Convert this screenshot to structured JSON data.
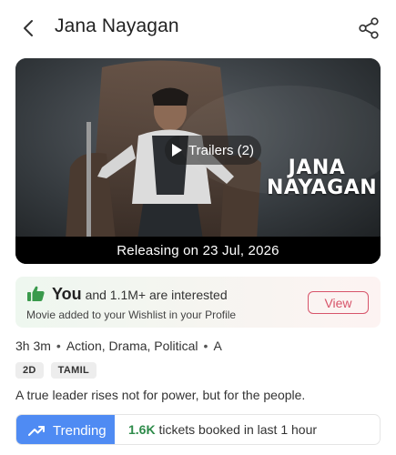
{
  "header": {
    "title": "Jana Nayagan",
    "back_icon": "chevron-left-icon",
    "share_icon": "share-icon"
  },
  "poster": {
    "trailer_label": "Trailers (2)",
    "logo_line1": "JANA",
    "logo_line2": "NAYAGAN",
    "release_text": "Releasing on 23 Jul, 2026"
  },
  "interest": {
    "you": "You",
    "and_text": "and 1.1M+",
    "suffix": "are interested",
    "subtext": "Movie added to your Wishlist in your Profile",
    "view_label": "View",
    "accent_color": "#d7546a",
    "thumb_color": "#3a9a4c"
  },
  "meta": {
    "duration": "3h 3m",
    "genres": "Action, Drama, Political",
    "certificate": "A"
  },
  "tags": [
    "2D",
    "TAMIL"
  ],
  "tagline": "A true leader rises not for power, but for the people.",
  "trending": {
    "label": "Trending",
    "count": "1.6K",
    "text": "tickets booked in last 1 hour",
    "badge_color": "#4f8bf3"
  }
}
